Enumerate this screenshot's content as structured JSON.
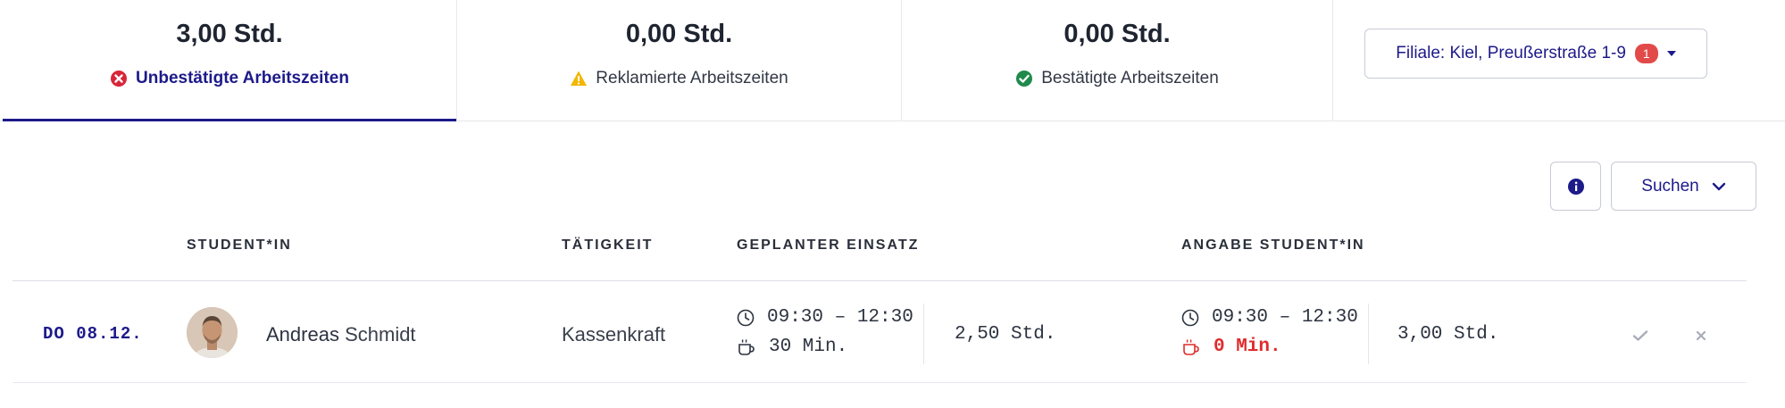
{
  "tabs": [
    {
      "value": "3,00 Std.",
      "label": "Unbestätigte Arbeitszeiten",
      "icon": "error-circle-icon",
      "color": "#d8263a"
    },
    {
      "value": "0,00 Std.",
      "label": "Reklamierte Arbeitszeiten",
      "icon": "warning-triangle-icon",
      "color": "#f2b705"
    },
    {
      "value": "0,00 Std.",
      "label": "Bestätigte Arbeitszeiten",
      "icon": "check-circle-icon",
      "color": "#1f8a4c"
    }
  ],
  "filiale": {
    "label": "Filiale: Kiel, Preußerstraße 1-9",
    "badge": "1"
  },
  "toolbar": {
    "search_label": "Suchen"
  },
  "table": {
    "headers": {
      "student": "STUDENT*IN",
      "taetigkeit": "TÄTIGKEIT",
      "geplant": "GEPLANTER EINSATZ",
      "angabe": "ANGABE STUDENT*IN"
    },
    "rows": [
      {
        "date": "DO 08.12.",
        "first_name": "Andreas",
        "last_name": "Schmidt",
        "taetigkeit": "Kassenkraft",
        "plan_time": "09:30 – 12:30",
        "plan_break": "30 Min.",
        "plan_hours": "2,50 Std.",
        "ang_time": "09:30 – 12:30",
        "ang_break": "0 Min.",
        "ang_hours": "3,00 Std."
      }
    ]
  },
  "colors": {
    "accent": "#1d1a8a",
    "danger": "#e02b2b",
    "success": "#1f8a4c",
    "warning": "#f2b705"
  }
}
